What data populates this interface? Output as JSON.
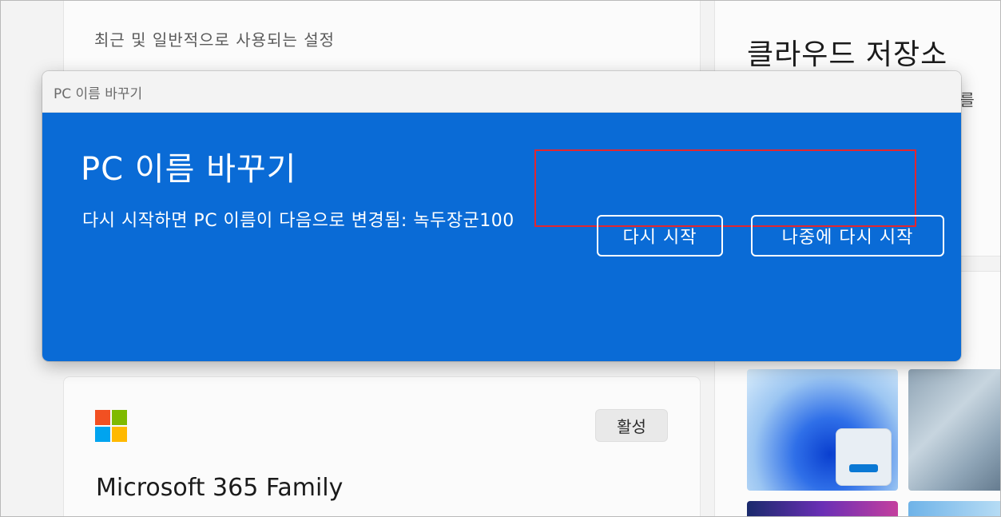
{
  "background": {
    "recent_settings_label": "최근 및 일반적으로 사용되는 설정",
    "cloud_storage_title": "클라우드 저장소",
    "cloud_storage_sub": "보를",
    "ms_card": {
      "title": "Microsoft 365 Family",
      "badge": "활성"
    }
  },
  "dialog": {
    "window_title": "PC 이름 바꾸기",
    "heading": "PC 이름 바꾸기",
    "message": "다시 시작하면 PC 이름이 다음으로 변경됨: 녹두장군100",
    "buttons": {
      "restart_label": "다시 시작",
      "later_label": "나중에 다시 시작"
    }
  },
  "colors": {
    "dialog_accent": "#0a6bd6",
    "highlight_border": "#e3262f"
  }
}
